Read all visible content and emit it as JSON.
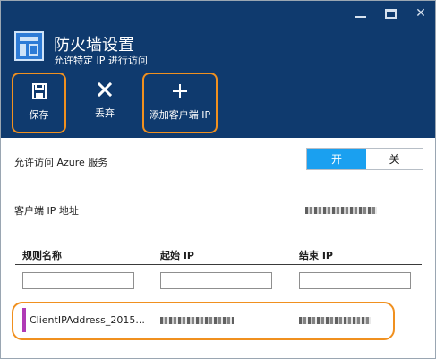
{
  "window_controls": {
    "minimize": "",
    "maximize": "",
    "close": "✕"
  },
  "header": {
    "title": "防火墙设置",
    "subtitle": "允许特定 IP 进行访问"
  },
  "toolbar": {
    "save_label": "保存",
    "discard_label": "丢弃",
    "add_client_ip_label": "添加客户端 IP",
    "icons": {
      "save": "save-icon",
      "discard": "close-icon",
      "add": "plus-icon"
    }
  },
  "azure_access": {
    "label": "允许访问 Azure 服务",
    "on_label": "开",
    "off_label": "关",
    "selected": "on"
  },
  "client_ip": {
    "label": "客户端 IP 地址"
  },
  "rules_table": {
    "columns": [
      "规则名称",
      "起始 IP",
      "结束 IP"
    ],
    "filters": [
      "",
      "",
      ""
    ],
    "rows": [
      {
        "name": "ClientIPAddress_2015..."
      }
    ]
  },
  "colors": {
    "header_bg": "#0f3a6e",
    "accent_orange": "#f0901f",
    "toggle_on": "#1aa0f0",
    "row_marker": "#b03ab5"
  }
}
